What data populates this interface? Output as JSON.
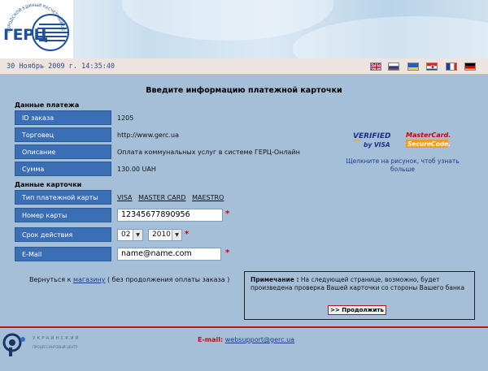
{
  "header": {
    "logo_text": "ГЕРЦ",
    "logo_arc_text": "ГОРОДСКОЙ ЕДИНЫЙ РАСЧЕТНЫЙ ЦЕНТР"
  },
  "datebar": {
    "datetime": "30 Ноябрь 2009 г. 14:35:40",
    "languages": [
      "english-flag",
      "russian-flag",
      "ukrainian-flag",
      "croatian-flag",
      "french-flag",
      "german-flag"
    ]
  },
  "page_title": "Введите информацию платежной карточки",
  "payment": {
    "section_title": "Данные платежа",
    "rows": [
      {
        "label": "ID заказа",
        "value": "1205"
      },
      {
        "label": "Торговец",
        "value": "http://www.gerc.ua"
      },
      {
        "label": "Описание",
        "value": "Оплата коммунальных услуг в системе ГЕРЦ-Онлайн"
      },
      {
        "label": "Сумма",
        "value": "130.00 UAH"
      }
    ]
  },
  "card": {
    "section_title": "Данные карточки",
    "type_label": "Тип платежной карты",
    "types": [
      "VISA",
      "MASTER CARD",
      "MAESTRO"
    ],
    "number_label": "Номер карты",
    "number_value": "12345677890956",
    "expiry_label": "Срок действия",
    "expiry_month": "02",
    "expiry_year": "2010",
    "email_label": "E-Mail",
    "email_value": "name@name.com",
    "required_mark": "*"
  },
  "badges": {
    "verified_line1": "VERIFIED",
    "verified_line2": "by VISA",
    "mastercard_line1": "MasterCard.",
    "mastercard_line2": "SecureCode.",
    "click_hint": "Щелкните на рисунок, чтоб узнать больше"
  },
  "back": {
    "prefix": "Вернуться к ",
    "link": "магазину",
    "suffix": " ( без продолжения оплаты заказа )"
  },
  "note": {
    "label": "Примечание :",
    "text": " На следующей странице, возможно, будет произведена проверка Вашей карточки со стороны Вашего банка",
    "button": ">> Продолжить"
  },
  "footer": {
    "brand": "УКРАИНСКИЙ",
    "brand_sub": "ПРОЦЕССИНГОВЫЙ ЦЕНТР",
    "email_label": "E-mail:",
    "email_value": "websupport@gerc.ua"
  },
  "colors": {
    "page_bg": "#a6bfd9",
    "label_bg": "#3a6fb5",
    "accent_red": "#b31414",
    "link_blue": "#1a3c8a"
  }
}
